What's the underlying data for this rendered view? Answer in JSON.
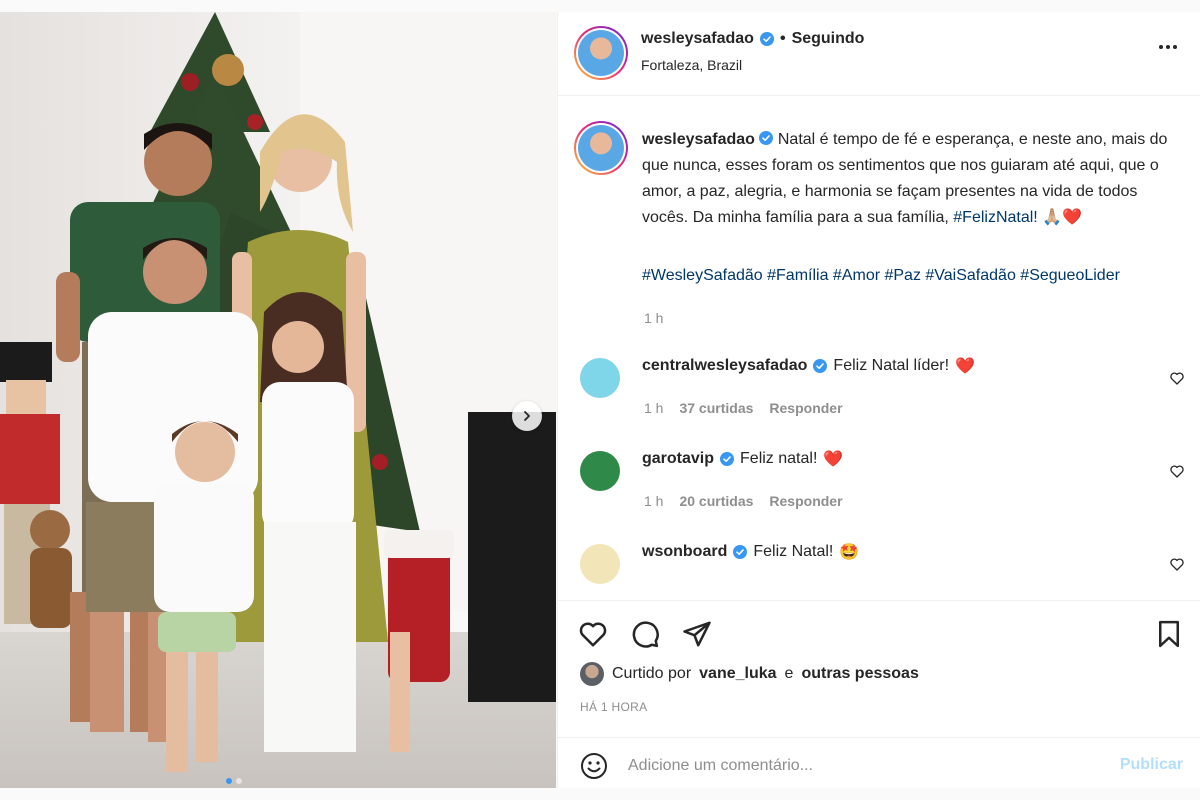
{
  "post": {
    "username": "wesleysafadao",
    "follow_separator": "•",
    "follow_status": "Seguindo",
    "location": "Fortaleza, Brazil",
    "verified": true
  },
  "caption": {
    "username": "wesleysafadao",
    "text": "Natal é tempo de fé e esperança, e neste ano, mais do que nunca, esses foram os sentimentos que nos guiaram até aqui, que o amor, a paz, alegria, e harmonia se façam presentes na vida de todos vocês. Da minha família para a sua família,",
    "hashtag_inline": "#FelizNatal!",
    "emojis": "🙏🏼❤️",
    "hashtags": "#WesleySafadão #Família #Amor #Paz #VaiSafadão #SegueoLider",
    "time": "1 h"
  },
  "comments": [
    {
      "username": "centralwesleysafadao",
      "text": "Feliz Natal líder!",
      "emoji": "❤️",
      "time": "1 h",
      "likes": "37 curtidas",
      "reply": "Responder",
      "avatar_color": "#7fd6e8"
    },
    {
      "username": "garotavip",
      "text": "Feliz natal!",
      "emoji": "❤️",
      "time": "1 h",
      "likes": "20 curtidas",
      "reply": "Responder",
      "avatar_color": "#2f8a4a"
    },
    {
      "username": "wsonboard",
      "text": "Feliz Natal!",
      "emoji": "🤩",
      "avatar_color": "#f2e6b8"
    }
  ],
  "likes_line": {
    "prefix": "Curtido por",
    "user": "vane_luka",
    "conjunction": "e",
    "others": "outras pessoas"
  },
  "time_ago": "HÁ 1 HORA",
  "composer": {
    "placeholder": "Adicione um comentário...",
    "publish_label": "Publicar"
  },
  "carousel": {
    "index": 1,
    "count": 2
  },
  "colors": {
    "accent": "#0095f6",
    "verified": "#3897f0",
    "text": "#262626",
    "muted": "#8e8e8e",
    "hashtag": "#00376b",
    "heart": "#e11d2a"
  },
  "icons": [
    "verified-icon",
    "more-icon",
    "heart-icon",
    "comment-icon",
    "share-icon",
    "bookmark-icon",
    "emoji-icon",
    "chevron-right-icon"
  ]
}
